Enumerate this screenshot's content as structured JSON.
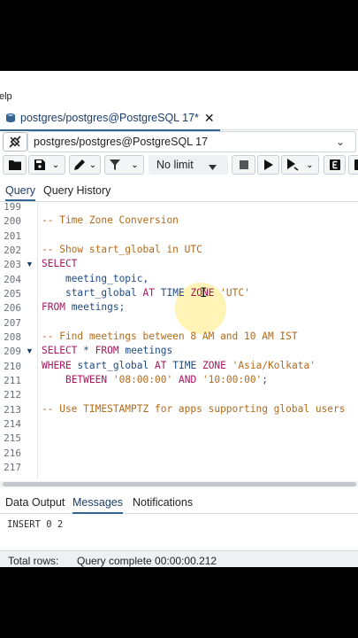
{
  "menubar": {
    "help": "elp"
  },
  "tab": {
    "title": "postgres/postgres@PostgreSQL 17*",
    "close": "✕"
  },
  "connection": {
    "value": "postgres/postgres@PostgreSQL 17",
    "chevron": "⌄"
  },
  "toolbar": {
    "limit_label": "No limit"
  },
  "query_tabs": [
    "Query",
    "Query History"
  ],
  "editor": {
    "line_numbers": [
      "199",
      "200",
      "201",
      "202",
      "203",
      "204",
      "205",
      "206",
      "207",
      "208",
      "209",
      "210",
      "211",
      "212",
      "213",
      "214",
      "215",
      "216",
      "217"
    ],
    "cursor": "I"
  },
  "output_tabs": [
    "Data Output",
    "Messages",
    "Notifications"
  ],
  "messages": {
    "text": "INSERT 0 2"
  },
  "status": {
    "total_rows": "Total rows:",
    "query_status": "Query complete 00:00:00.212"
  }
}
